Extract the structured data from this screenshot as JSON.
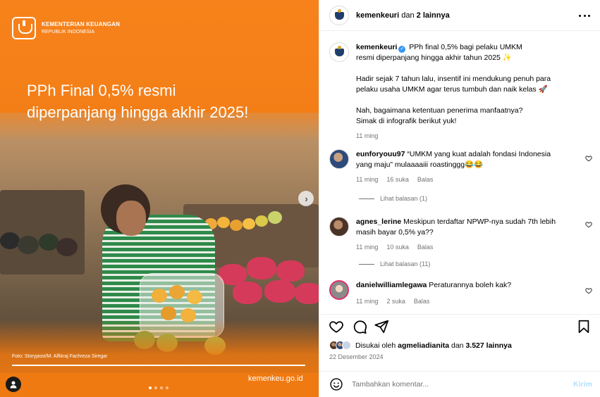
{
  "media": {
    "brand_line1": "KEMENTERIAN KEUANGAN",
    "brand_line2": "REPUBLIK INDONESIA",
    "headline_line1": "PPh Final 0,5% resmi",
    "headline_line2": "diperpanjang hingga akhir 2025!",
    "photo_credit": "Foto: Storypost/M. Alfikraj Fachreza Siregar",
    "website": "kemenkeu.go.id",
    "carousel_total": 4,
    "carousel_active": 1,
    "accent_color": "#f07a12"
  },
  "header": {
    "account": "kemenkeuri",
    "collab_text": "dan",
    "collab_others": "2 lainnya",
    "more_icon": "more-horizontal-icon"
  },
  "caption": {
    "account": "kemenkeuri",
    "line1": "PPh final 0,5% bagi pelaku UMKM",
    "line2": "resmi diperpanjang hingga akhir tahun 2025 ✨",
    "para2_line1": "Hadir sejak 7 tahun lalu, insentif ini mendukung penuh para",
    "para2_line2": "pelaku usaha UMKM agar terus tumbuh dan naik kelas 🚀",
    "para3_line1": "Nah, bagaimana ketentuan penerima manfaatnya?",
    "para3_line2": "Simak di infografik berikut yuk!",
    "time": "11 ming"
  },
  "comments": [
    {
      "user": "eunforyouu97",
      "text_line1": "“UMKM yang kuat adalah fondasi Indonesia",
      "text_line2": "yang maju” mulaaaaiii roastinggg😂😂",
      "time": "11 ming",
      "likes": "16 suka",
      "reply": "Balas",
      "replies_label": "Lihat balasan (1)"
    },
    {
      "user": "agnes_lerine",
      "text_line1": "Meskipun terdaftar NPWP-nya sudah 7th lebih",
      "text_line2": "masih bayar 0,5% ya??",
      "time": "11 ming",
      "likes": "10 suka",
      "reply": "Balas",
      "replies_label": "Lihat balasan (11)"
    },
    {
      "user": "danielwilliamlegawa",
      "text_line1": "Peraturannya boleh kak?",
      "text_line2": "",
      "time": "11 ming",
      "likes": "2 suka",
      "reply": "Balas",
      "replies_label": ""
    }
  ],
  "likes": {
    "prefix": "Disukai oleh",
    "user": "agmeliadianita",
    "middle": "dan",
    "count": "3.527 lainnya"
  },
  "date": "22 Desember 2024",
  "composer": {
    "placeholder": "Tambahkan komentar...",
    "send_label": "Kirim"
  }
}
